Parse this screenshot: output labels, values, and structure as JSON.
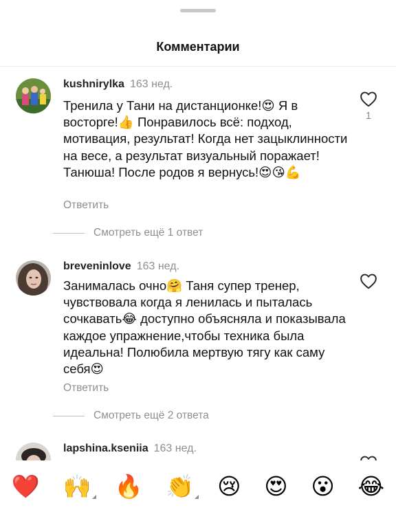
{
  "header": {
    "title": "Комментарии"
  },
  "comments": [
    {
      "username": "kushnirylka",
      "time": "163 нед.",
      "text": "Тренила у Тани на дистанционке!😍 Я в восторге!👍 Понравилось всё: подход, мотивация, результат! Когда нет зацыклинности на весе, а результат визуальный поражает! Танюша! После родов я вернусь!😍😘💪",
      "reply_label": "Ответить",
      "likes": "1",
      "more_replies": "Смотреть ещё 1 ответ"
    },
    {
      "username": "breveninlove",
      "time": "163 нед.",
      "text": "Занималась очно🤗 Таня супер тренер, чувствовала когда я ленилась и пыталась сочкавать😂 доступно объясняла и показывала каждое упражнение,чтобы техника была идеальна! Полюбила мертвую тягу как саму себя😍",
      "reply_label": "Ответить",
      "more_replies": "Смотреть ещё 2 ответа"
    },
    {
      "username": "lapshina.kseniia",
      "time": "163 нед."
    }
  ],
  "reactions": [
    "❤️",
    "🙌",
    "🔥",
    "👏",
    "😢",
    "😍",
    "😮",
    "😂"
  ],
  "colors": {
    "secondary_text": "#8e8e8e",
    "heart_outline": "#262626",
    "emoji_heart": "#ed4956"
  }
}
